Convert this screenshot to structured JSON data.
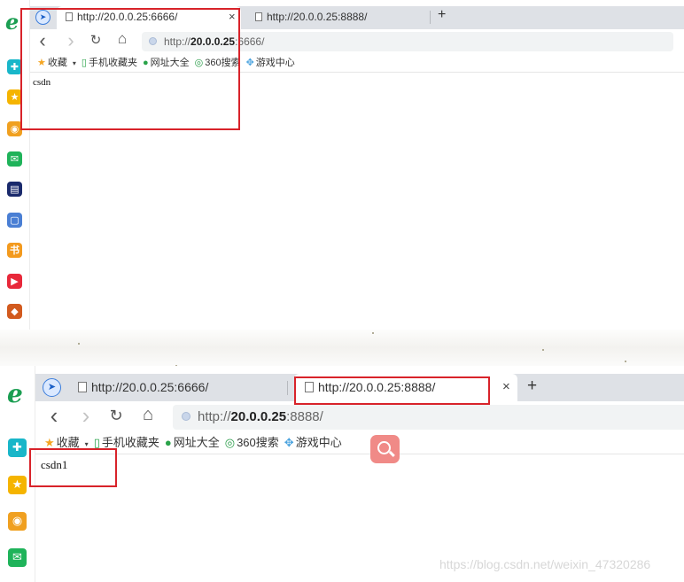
{
  "top": {
    "tabs": [
      {
        "title": "http://20.0.0.25:6666/",
        "active": true
      },
      {
        "title": "http://20.0.0.25:8888/",
        "active": false
      }
    ],
    "close_glyph": "×",
    "new_tab_glyph": "+",
    "address": {
      "prefix": "http://",
      "host": "20.0.0.25",
      "rest": ":6666/"
    },
    "bookmarks": [
      {
        "icon": "star-icon",
        "glyph": "★",
        "label": "收藏",
        "color": "#f5a623",
        "dropdown": true
      },
      {
        "icon": "phone-icon",
        "glyph": "▯",
        "label": "手机收藏夹",
        "color": "#2aa34a"
      },
      {
        "icon": "globe-icon",
        "glyph": "●",
        "label": "网址大全",
        "color": "#2aa34a"
      },
      {
        "icon": "search-360-icon",
        "glyph": "◎",
        "label": "360搜索",
        "color": "#2a9d4a"
      },
      {
        "icon": "game-icon",
        "glyph": "✥",
        "label": "游戏中心",
        "color": "#4aa3df"
      }
    ],
    "page_text": "csdn"
  },
  "bottom": {
    "tabs": [
      {
        "title": "http://20.0.0.25:6666/",
        "active": false
      },
      {
        "title": "http://20.0.0.25:8888/",
        "active": true
      }
    ],
    "close_glyph": "×",
    "new_tab_glyph": "+",
    "address": {
      "prefix": "http://",
      "host": "20.0.0.25",
      "rest": ":8888/"
    },
    "bookmarks": [
      {
        "icon": "star-icon",
        "glyph": "★",
        "label": "收藏",
        "color": "#f5a623",
        "dropdown": true
      },
      {
        "icon": "phone-icon",
        "glyph": "▯",
        "label": "手机收藏夹",
        "color": "#2aa34a"
      },
      {
        "icon": "globe-icon",
        "glyph": "●",
        "label": "网址大全",
        "color": "#2aa34a"
      },
      {
        "icon": "search-360-icon",
        "glyph": "◎",
        "label": "360搜索",
        "color": "#2a9d4a"
      },
      {
        "icon": "game-icon",
        "glyph": "✥",
        "label": "游戏中心",
        "color": "#4aa3df"
      }
    ],
    "page_text": "csdn1"
  },
  "sidebar_icons": [
    {
      "name": "plus-app-icon",
      "glyph": "✚",
      "color": "#19b6c9"
    },
    {
      "name": "favorites-star-icon",
      "glyph": "★",
      "color": "#f5b400"
    },
    {
      "name": "weibo-icon",
      "glyph": "◉",
      "color": "#f0a020"
    },
    {
      "name": "mail-icon",
      "glyph": "✉",
      "color": "#1fb35a"
    },
    {
      "name": "news-app-icon",
      "glyph": "▤",
      "color": "#1a2a6c"
    },
    {
      "name": "document-icon",
      "glyph": "▢",
      "color": "#4a7fd4"
    },
    {
      "name": "novel-app-icon",
      "glyph": "书",
      "color": "#f39a1e"
    },
    {
      "name": "video-app-icon",
      "glyph": "▶",
      "color": "#e8283a"
    },
    {
      "name": "game-app-icon",
      "glyph": "◆",
      "color": "#d25a1e"
    }
  ],
  "nav_glyphs": {
    "back": "‹",
    "forward": "›",
    "reload": "↻",
    "home": "⌂",
    "compass": "➤"
  },
  "watermark": "https://blog.csdn.net/weixin_47320286"
}
